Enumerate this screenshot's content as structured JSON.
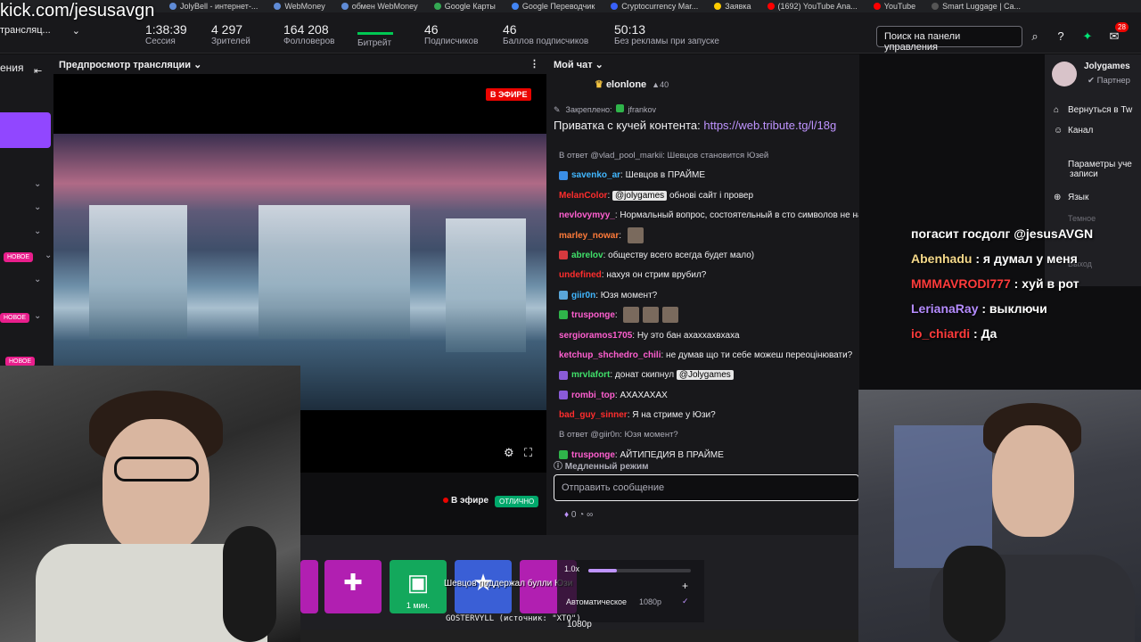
{
  "watermark": "kick.com/jesusavgn",
  "bookmarks": [
    "JolyBell - интернет-...",
    "WebMoney",
    "обмен WebMoney",
    "Google Карты",
    "Google Переводчик",
    "Cryptocurrency Mar...",
    "Заявка",
    "(1692) YouTube Ana...",
    "YouTube",
    "Smart Luggage | Ca..."
  ],
  "channel_selector": "трансляц...",
  "stats": [
    {
      "value": "1:38:39",
      "label": "Сессия"
    },
    {
      "value": "4 297",
      "label": "Зрителей"
    },
    {
      "value": "164 208",
      "label": "Фолловеров"
    },
    {
      "value": "",
      "label": "Битрейт",
      "bar_level": 1.0
    },
    {
      "value": "46",
      "label": "Подписчиков"
    },
    {
      "value": "46",
      "label": "Баллов подписчиков"
    },
    {
      "value": "50:13",
      "label": "Без рекламы при запуске"
    }
  ],
  "search_placeholder": "Поиск на панели управления",
  "notification_count": "28",
  "sidebar": {
    "title": "ения",
    "new_tags": [
      "НОВОЕ",
      "НОВОЕ",
      "НОВОЕ"
    ]
  },
  "preview": {
    "title": "Предпросмотр трансляции",
    "live_badge": "В ЭФИРЕ",
    "status_label": "В эфире",
    "health_badge": "ОТЛИЧНО"
  },
  "chat": {
    "title": "Мой чат",
    "top_user": "elonlone",
    "top_user_count": "40",
    "pinned_label": "Закреплено:",
    "pinned_by": "jfrankov",
    "pinned_text": "Приватка с кучей контента: ",
    "pinned_link": "https://web.tribute.tg/l/18g",
    "messages": [
      {
        "type": "reply",
        "text": "В ответ @vlad_pool_markii: Шевцов становится Юзей"
      },
      {
        "user": "savenko_ar",
        "color": "#41b7ff",
        "text": "Шевцов в ПРАЙМЕ",
        "icon": "#3a8ee6"
      },
      {
        "user": "MelanColor",
        "color": "#ff2d2d",
        "text": "",
        "mention": "@jolygames",
        "after": " обнові сайт і провер"
      },
      {
        "user": "nevlovymyy_",
        "color": "#ff5fd0",
        "text": "Нормальный вопрос, состоятельный в сто символов не написать",
        "mention": "@Jolygames"
      },
      {
        "user": "marley_nowar",
        "color": "#ff7b3a",
        "text": "",
        "emotes": 1
      },
      {
        "user": "abrelov",
        "color": "#40e06a",
        "text": "обществу всего всегда будет мало)",
        "icon": "#d8393e"
      },
      {
        "user": "undefined",
        "color": "#ff2d2d",
        "text": "нахуя он стрим врубил?"
      },
      {
        "user": "giir0n",
        "color": "#41b7ff",
        "text": "Юзя момент?",
        "icon": "#5aa6d9"
      },
      {
        "user": "trusponge",
        "color": "#ff5fd0",
        "text": "",
        "emotes": 3,
        "icon": "#2fb44a"
      },
      {
        "user": "sergioramos1705",
        "color": "#ff5fd0",
        "text": "Ну это бан ахаххахвхаха"
      },
      {
        "user": "ketchup_shchedro_chili",
        "color": "#ff5fd0",
        "text": "не думав що ти себе можеш переоцінювати?"
      },
      {
        "user": "mrvlafort",
        "color": "#40e06a",
        "text": "донат скипнул",
        "mention": "@Jolygames",
        "icon": "#8a5bd8"
      },
      {
        "user": "rombi_top",
        "color": "#ff5fd0",
        "text": "АХАХАХАХ",
        "icon": "#8a5bd8"
      },
      {
        "user": "bad_guy_sinner",
        "color": "#ff2d2d",
        "text": "Я на стриме у Юзи?"
      },
      {
        "type": "reply",
        "text": "В ответ @giir0n: Юзя момент?"
      },
      {
        "user": "trusponge",
        "color": "#ff5fd0",
        "text": "АЙТИПЕДИЯ В ПРАЙМЕ",
        "icon": "#2fb44a"
      }
    ],
    "slow_mode": "Медленный режим",
    "input_placeholder": "Отправить сообщение",
    "points": "0",
    "points_extra": "∞"
  },
  "overlay_chat": [
    {
      "user": "",
      "color": "#ffffff",
      "text": "погасит госдолг @jesusAVGN"
    },
    {
      "user": "Abenhadu",
      "color": "#f5d98a",
      "text": " : я думал у меня"
    },
    {
      "user": "MMMAVRODI777",
      "color": "#ff3b3b",
      "text": " : хуй в рот"
    },
    {
      "user": "LerianaRay",
      "color": "#b58cff",
      "text": " : выключи"
    },
    {
      "user": "io_chiardi",
      "color": "#ff3b3b",
      "text": " : Да"
    }
  ],
  "right_menu": {
    "name": "Jolygames",
    "role": "Партнер",
    "items": [
      "Вернуться в Tw",
      "Канал",
      "Параметры уче записи",
      "Язык",
      "Темное",
      "Выход"
    ]
  },
  "quick_actions": [
    {
      "label": "",
      "color": "#b11fb1"
    },
    {
      "label": "",
      "color": "#b11fb1"
    },
    {
      "label": "1 мин.",
      "color": "#13a85c"
    },
    {
      "label": "",
      "color": "#3a5fd6"
    },
    {
      "label": "",
      "color": "#b11fb1"
    }
  ],
  "alert_text": "Шевцов поддержал булли Юзи",
  "speed": {
    "value": "1.0x",
    "level": 0.28,
    "quality": "Автоматическое",
    "quality_res": "1080p"
  },
  "quality_label": "1080p",
  "gost_text": "GOSTERVYLL (источник: \"XTO\")"
}
